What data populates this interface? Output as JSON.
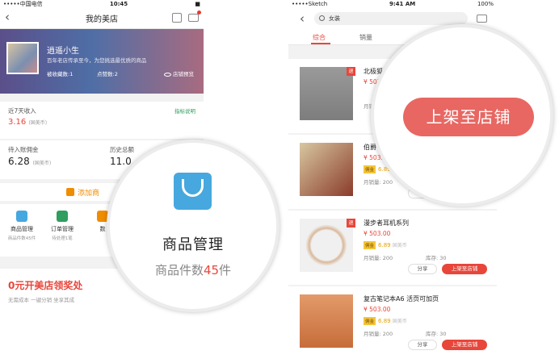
{
  "left_screen": {
    "status": {
      "carrier": "•••••中国电信",
      "time": "10:45",
      "battery": "■"
    },
    "nav": {
      "back": "‹",
      "title": "我的美店"
    },
    "banner": {
      "name": "逍遥小生",
      "desc": "百年老店传承至今，为您挑选最优质的商品",
      "collect_label": "被收藏数:1",
      "like_label": "点赞数:2",
      "preview_label": "店铺预览"
    },
    "income": {
      "label": "近7天收入",
      "link": "指标说明",
      "value": "3.16",
      "unit": "(国美币)"
    },
    "commission": {
      "pending_label": "待入账佣金",
      "pending_value": "6.28",
      "pending_unit": "(国美币)",
      "history_label": "历史总额",
      "history_value": "11.0"
    },
    "add_product": "添加商",
    "grid": [
      {
        "title": "商品管理",
        "sub": "商品件数45件",
        "color": "#46a8de"
      },
      {
        "title": "订单管理",
        "sub": "待处理1笔",
        "color": "#2f9e5f"
      },
      {
        "title": "数",
        "sub": "",
        "color": "#f08c00"
      }
    ],
    "promo": {
      "title": "0元开美店领奖处",
      "sub": "无需成本  一键分销  坐享其成"
    },
    "zoom": {
      "title": "商品管理",
      "sub_prefix": "商品件数",
      "sub_num": "45",
      "sub_suffix": "件"
    }
  },
  "right_screen": {
    "status": {
      "carrier": "•••••Sketch",
      "time": "9:41 AM",
      "battery": "100%"
    },
    "search": {
      "back": "‹",
      "query": "女装"
    },
    "tabs": [
      "综合",
      "销量"
    ],
    "items": [
      {
        "name": "北极狐",
        "price": "¥ 503.0",
        "commission_badge": "",
        "commission": "",
        "commission_unit": "",
        "sales": "月销",
        "stock": "",
        "share": "",
        "shelf": "",
        "tag": "退"
      },
      {
        "name": "伯爵",
        "price": "¥ 503.0",
        "commission_badge": "佣金",
        "commission": "6.89",
        "commission_unit": "国美币",
        "sales": "月销量: 200",
        "stock": "库",
        "share": "分享",
        "shelf": "",
        "tag": ""
      },
      {
        "name": "漫步者耳机系列",
        "price": "¥ 503.00",
        "commission_badge": "佣金",
        "commission": "6.89",
        "commission_unit": "国美币",
        "sales": "月销量: 200",
        "stock": "库存: 30",
        "share": "分享",
        "shelf": "上架至店铺",
        "tag": "退"
      },
      {
        "name": "复古笔记本A6 活页可加页",
        "price": "¥ 503.00",
        "commission_badge": "佣金",
        "commission": "6.89",
        "commission_unit": "国美币",
        "sales": "月销量: 200",
        "stock": "库存: 30",
        "share": "分享",
        "shelf": "上架至店铺",
        "tag": ""
      }
    ],
    "zoom_button": "上架至店铺"
  }
}
